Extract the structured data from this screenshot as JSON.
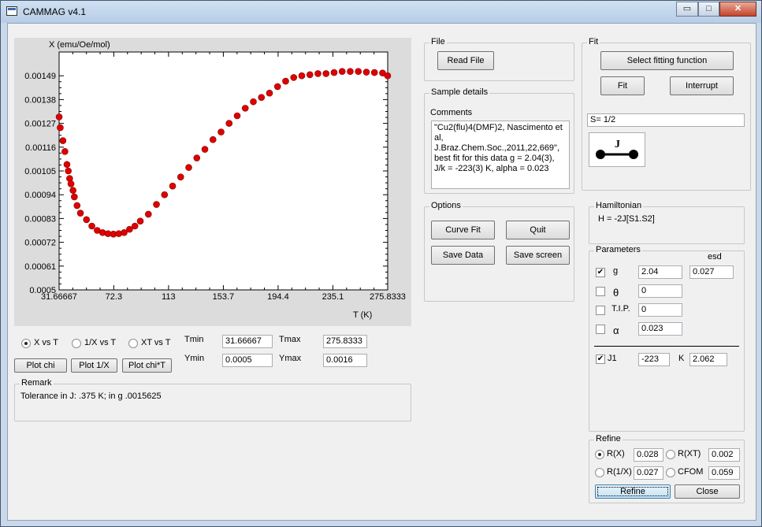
{
  "window": {
    "title": "CAMMAG v4.1",
    "controls": {
      "minimize": "▭",
      "maximize": "□",
      "close": "✕"
    }
  },
  "chart_data": {
    "type": "scatter",
    "ylabel": "X (emu/Oe/mol)",
    "xlabel": "T (K)",
    "xlim": [
      31.66667,
      275.8333
    ],
    "ylim": [
      0.0005,
      0.0016
    ],
    "xticks": [
      "31.66667",
      "72.3",
      "113",
      "153.7",
      "194.4",
      "235.1",
      "275.8333"
    ],
    "xtick_values": [
      31.66667,
      72.3,
      113,
      153.7,
      194.4,
      235.1,
      275.8333
    ],
    "yticks": [
      "0.00149",
      "0.00138",
      "0.00127",
      "0.00116",
      "0.00105",
      "0.00094",
      "0.00083",
      "0.00072",
      "0.00061",
      "0.0005"
    ],
    "ytick_values": [
      0.00149,
      0.00138,
      0.00127,
      0.00116,
      0.00105,
      0.00094,
      0.00083,
      0.00072,
      0.00061,
      0.0005
    ],
    "marker_color": "#dd0000",
    "series": [
      {
        "x": [
          31.7,
          32.5,
          34.5,
          36.0,
          37.5,
          38.5,
          39.5,
          40.5,
          42.0,
          43.0,
          45.0,
          47.5,
          52.0,
          56.0,
          60.0,
          64.0,
          68.0,
          72.0,
          76.0,
          80.0,
          84.0,
          88.0,
          92.0,
          98.0,
          104.0,
          110.0,
          116.0,
          122.0,
          128.0,
          134.0,
          140.0,
          146.0,
          152.0,
          158.0,
          164.0,
          170.0,
          176.0,
          182.0,
          188.0,
          194.0,
          200.0,
          206.0,
          212.0,
          218.0,
          224.0,
          230.0,
          236.0,
          242.0,
          248.0,
          254.0,
          260.0,
          266.0,
          272.0,
          275.8
        ],
        "y": [
          0.0013,
          0.00125,
          0.00119,
          0.00114,
          0.00108,
          0.00105,
          0.001015,
          0.00099,
          0.00096,
          0.00093,
          0.00089,
          0.000855,
          0.000825,
          0.000795,
          0.000775,
          0.000765,
          0.00076,
          0.000758,
          0.00076,
          0.000765,
          0.00078,
          0.000795,
          0.000818,
          0.00085,
          0.000895,
          0.00094,
          0.00098,
          0.001022,
          0.001066,
          0.00111,
          0.00115,
          0.001195,
          0.00123,
          0.00127,
          0.001305,
          0.00134,
          0.00137,
          0.00139,
          0.00141,
          0.00144,
          0.001465,
          0.001482,
          0.00149,
          0.001495,
          0.0015,
          0.0015,
          0.001505,
          0.00151,
          0.00151,
          0.00151,
          0.001507,
          0.001505,
          0.001503,
          0.00149
        ]
      }
    ]
  },
  "plot_mode": {
    "options": [
      "X vs T",
      "1/X vs T",
      "XT vs T"
    ],
    "selected": 0
  },
  "ranges": {
    "tmin_label": "Tmin",
    "tmin": "31.66667",
    "tmax_label": "Tmax",
    "tmax": "275.8333",
    "ymin_label": "Ymin",
    "ymin": "0.0005",
    "ymax_label": "Ymax",
    "ymax": "0.0016"
  },
  "plot_buttons": {
    "plot_chi": "Plot chi",
    "plot_inv": "Plot 1/X",
    "plot_chit": "Plot chi*T"
  },
  "remark": {
    "legend": "Remark",
    "text": "Tolerance in J:  .375 K; in g .0015625"
  },
  "file": {
    "legend": "File",
    "read_file": "Read File"
  },
  "sample": {
    "legend": "Sample details",
    "comments_label": "Comments",
    "comments": "\"Cu2(flu)4(DMF)2, Nascimento et al, J.Braz.Chem.Soc.,2011,22,669\", best fit for this data g = 2.04(3), J/k = -223(3) K, alpha = 0.023"
  },
  "options": {
    "legend": "Options",
    "curve_fit": "Curve Fit",
    "quit": "Quit",
    "save_data": "Save Data",
    "save_screen": "Save screen"
  },
  "fit": {
    "legend": "Fit",
    "select_function": "Select fitting function",
    "fit": "Fit",
    "interrupt": "Interrupt",
    "spin": "S= 1/2",
    "diagram_label": "J"
  },
  "hamiltonian": {
    "legend": "Hamiltonian",
    "text": "H = -2J[S1.S2]"
  },
  "parameters": {
    "legend": "Parameters",
    "esd_label": "esd",
    "items": [
      {
        "name": "g",
        "checked": "✔",
        "value": "2.04",
        "esd": "0.027"
      },
      {
        "name": "θ",
        "checked": "",
        "value": "0"
      },
      {
        "name": "T.I.P.",
        "checked": "",
        "value": "0"
      },
      {
        "name": "α",
        "checked": "",
        "value": "0.023"
      }
    ],
    "j1": {
      "name": "J1",
      "checked": "✔",
      "value": "-223",
      "unit": "K",
      "esd": "2.062"
    }
  },
  "refine": {
    "legend": "Refine",
    "r_x": "R(X)",
    "r_x_val": "0.028",
    "r_xt": "R(XT)",
    "r_xt_val": "0.002",
    "r_inv": "R(1/X)",
    "r_inv_val": "0.027",
    "cfom": "CFOM",
    "cfom_val": "0.059",
    "refine_btn": "Refine",
    "close_btn": "Close"
  }
}
